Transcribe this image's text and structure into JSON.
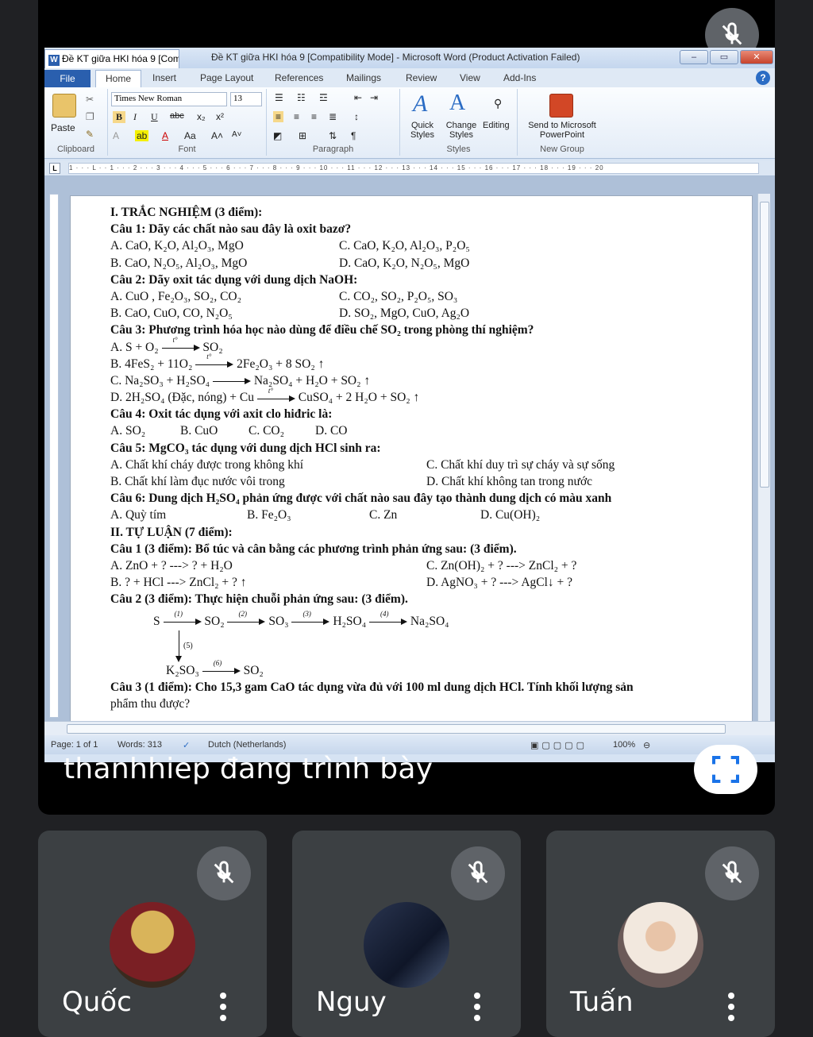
{
  "word": {
    "doc_tab": "Đề KT giữa HKI hóa 9 [Com",
    "title": "Đề KT giữa HKI hóa 9 [Compatibility Mode] - Microsoft Word (Product Activation Failed)",
    "ribbon_tabs": [
      "File",
      "Home",
      "Insert",
      "Page Layout",
      "References",
      "Mailings",
      "Review",
      "View",
      "Add-Ins"
    ],
    "font_name": "Times New Roman",
    "font_size": "13",
    "groups": {
      "clipboard": "Clipboard",
      "font": "Font",
      "paragraph": "Paragraph",
      "styles": "Styles",
      "new_group": "New Group"
    },
    "buttons": {
      "paste": "Paste",
      "quick_styles": "Quick Styles",
      "change_styles": "Change Styles",
      "editing": "Editing",
      "send_ppt": "Send to Microsoft PowerPoint"
    },
    "ruler": "1 · · · L · · 1 · · · 2 · · · 3 · · · 4 · · · 5 · · · 6 · · · 7 · · · 8 · · · 9 · · · 10 · · · 11 · · · 12 · · · 13 · · · 14 · · · 15 · · · 16 · · · 17 · · · 18 · · · 19 · · · 20",
    "status": {
      "page": "Page: 1 of 1",
      "words": "Words: 313",
      "language": "Dutch (Netherlands)",
      "zoom": "100%"
    }
  },
  "doc": {
    "s1_title": "I. TRẮC NGHIỆM (3 điểm):",
    "q1": "Câu 1: Dãy các chất nào sau đây là oxit bazơ?",
    "q1a": "A. CaO, K₂O, Al₂O₃, MgO",
    "q1c": "C. CaO, K₂O, Al₂O₃, P₂O₅",
    "q1b": "B. CaO, N₂O₅, Al₂O₃, MgO",
    "q1d": "D. CaO, K₂O, N₂O₅, MgO",
    "q2": "Câu 2: Dãy oxit tác dụng với dung dịch NaOH:",
    "q2a": "A. CuO , Fe₂O₃, SO₂, CO₂",
    "q2c": "C. CO₂, SO₂, P₂O₅, SO₃",
    "q2b": "B. CaO, CuO, CO, N₂O₅",
    "q2d": "D. SO₂, MgO, CuO, Ag₂O",
    "q3": "Câu 3: Phương trình hóa học nào dùng để điều chế SO₂ trong phòng thí nghiệm?",
    "q3a_l": "A. S + O₂",
    "q3a_r": "SO₂",
    "q3b_l": "B. 4FeS₂ + 11O₂",
    "q3b_r": "2Fe₂O₃ + 8 SO₂ ↑",
    "q3c_l": "C. Na₂SO₃ + H₂SO₄",
    "q3c_r": "Na₂SO₄ + H₂O + SO₂ ↑",
    "q3d_l": "D. 2H₂SO₄ (Đặc, nóng) + Cu",
    "q3d_r": "CuSO₄ + 2 H₂O + SO₂ ↑",
    "t_mark": "t°",
    "q4": "Câu 4: Oxit tác dụng với axit clo hiđric là:",
    "q4a": "A. SO₂",
    "q4b": "B. CuO",
    "q4c": "C. CO₂",
    "q4d": "D. CO",
    "q5": "Câu 5: MgCO₃ tác dụng với dung dịch HCl sinh ra:",
    "q5a": "A. Chất khí cháy được trong không khí",
    "q5c": "C. Chất khí duy trì sự cháy và sự sống",
    "q5b": "B. Chất khí làm đục nước vôi trong",
    "q5d": "D. Chất khí không tan trong nước",
    "q6": "Câu 6: Dung dịch H₂SO₄ phản ứng được với chất nào sau đây tạo thành dung dịch có màu xanh",
    "q6a": "A. Quỳ tím",
    "q6b": "B. Fe₂O₃",
    "q6c": "C. Zn",
    "q6d": "D. Cu(OH)₂",
    "s2_title": "II. TỰ LUẬN (7 điểm):",
    "e1": "Câu 1 (3 điểm): Bổ túc và cân bằng các phương trình phản ứng sau: (3 điểm).",
    "e1a": "A. ZnO + ? ---> ? + H₂O",
    "e1c": "C. Zn(OH)₂ + ? ---> ZnCl₂ + ?",
    "e1b": "B. ? + HCl ---> ZnCl₂ + ? ↑",
    "e1d": "D. AgNO₃ + ? ---> AgCl↓ + ?",
    "e2": "Câu 2 (3 điểm): Thực hiện chuỗi phản ứng sau: (3 điểm).",
    "chain": [
      "S",
      "SO₂",
      "SO₃",
      "H₂SO₄",
      "Na₂SO₄"
    ],
    "chain_steps": [
      "(1)",
      "(2)",
      "(3)",
      "(4)",
      "(5)",
      "(6)"
    ],
    "chain_k": "K₂SO₃",
    "chain_end": "SO₂",
    "e3a": "Câu 3 (1 điểm): Cho 15,3 gam CaO tác dụng vừa đủ với 100 ml dung dịch HCl. Tính khối lượng sản",
    "e3b": "phẩm thu được?"
  },
  "meet": {
    "presenting": "thanhhiep đang trình bày",
    "participants": [
      {
        "name": "Quốc"
      },
      {
        "name": "Nguy"
      },
      {
        "name": "Tuấn"
      }
    ]
  },
  "colors": {
    "meet_bg": "#202124",
    "tile_bg": "#3c4043",
    "word_blue": "#2a5fae"
  }
}
